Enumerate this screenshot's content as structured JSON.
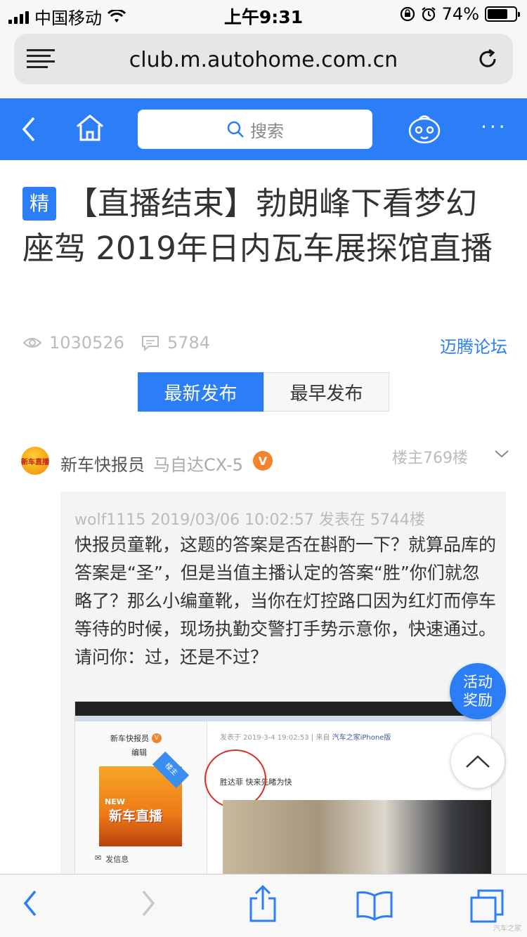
{
  "status_bar": {
    "carrier": "中国移动",
    "time": "上午9:31",
    "battery": "74%",
    "battery_level": 0.74
  },
  "url_bar": {
    "url": "club.m.autohome.com.cn"
  },
  "nav": {
    "search_placeholder": "搜索",
    "more": "···"
  },
  "thread": {
    "badge": "精",
    "title": "【直播结束】勃朗峰下看梦幻座驾 2019年日内瓦车展探馆直播",
    "views": "1030526",
    "replies": "5784",
    "forum": "迈腾论坛"
  },
  "tabs": {
    "latest": "最新发布",
    "earliest": "最早发布"
  },
  "post": {
    "avatar_text": "新车直播",
    "username": "新车快报员",
    "car": "马自达CX-5",
    "verified": "V",
    "floor": "楼主769楼",
    "quote_meta": "wolf1115 2019/03/06 10:02:57 发表在 5744楼",
    "quote_body": "快报员童靴，这题的答案是否在斟酌一下？就算品库的答案是“圣”，但是当值主播认定的答案“胜”你们就忽略了？那么小编童靴，当你在灯控路口因为红灯而停车等待的时候，现场执勤交警打手势示意你，快速通过。请问你：过，还是不过？"
  },
  "screenshot": {
    "name": "新车快报员",
    "v": "V",
    "role": "编辑",
    "corner": "楼主",
    "new": "NEW",
    "logo_text": "新车直播",
    "message": "发信息",
    "header_prefix": "发表于 2019-3-4 19:02:53 | 来自",
    "header_source": "汽车之家iPhone版",
    "text": "胜达菲 快来先睹为快"
  },
  "floating": {
    "reward": "活动奖励"
  },
  "watermark": "汽车之家"
}
